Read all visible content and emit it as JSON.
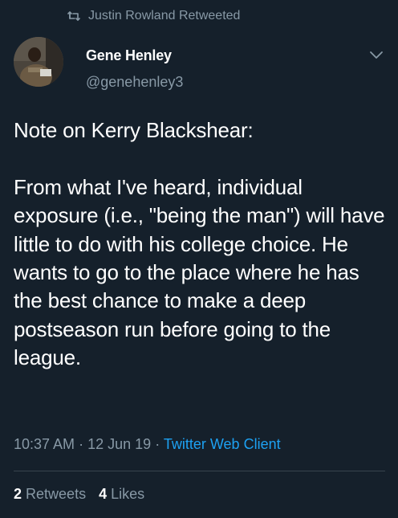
{
  "retweet_context": {
    "icon": "retweet-icon",
    "label": "Justin Rowland Retweeted"
  },
  "author": {
    "name": "Gene Henley",
    "handle": "@genehenley3"
  },
  "tweet": {
    "text": "Note on Kerry Blackshear:\n\nFrom what I've heard, individual exposure (i.e., \"being the man\") will have little to do with his college choice. He wants to go to the place where he has the best chance to make a deep postseason run before going to the league."
  },
  "meta": {
    "time": "10:37 AM",
    "separator": "·",
    "date": "12 Jun 19",
    "client": "Twitter Web Client"
  },
  "stats": {
    "retweets_count": "2",
    "retweets_label": "Retweets",
    "likes_count": "4",
    "likes_label": "Likes"
  },
  "colors": {
    "background": "#15202b",
    "secondary_text": "#8899a6",
    "link": "#1da1f2",
    "divider": "#38444d"
  }
}
